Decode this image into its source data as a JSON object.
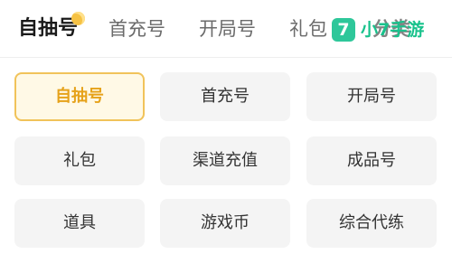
{
  "tabs": [
    {
      "label": "自抽号",
      "active": true
    },
    {
      "label": "首充号",
      "active": false
    },
    {
      "label": "开局号",
      "active": false
    },
    {
      "label": "礼包",
      "active": false
    }
  ],
  "overlap_tab_label": "分类",
  "brand": {
    "badge": "7",
    "name": "小7手游",
    "color": "#2ec79a"
  },
  "categories": [
    {
      "label": "自抽号",
      "selected": true
    },
    {
      "label": "首充号",
      "selected": false
    },
    {
      "label": "开局号",
      "selected": false
    },
    {
      "label": "礼包",
      "selected": false
    },
    {
      "label": "渠道充值",
      "selected": false
    },
    {
      "label": "成品号",
      "selected": false
    },
    {
      "label": "道具",
      "selected": false
    },
    {
      "label": "游戏币",
      "selected": false
    },
    {
      "label": "综合代练",
      "selected": false
    }
  ],
  "colors": {
    "accent": "#f1c35a",
    "accent_text": "#e6a21a",
    "chip_bg": "#f4f4f4"
  }
}
